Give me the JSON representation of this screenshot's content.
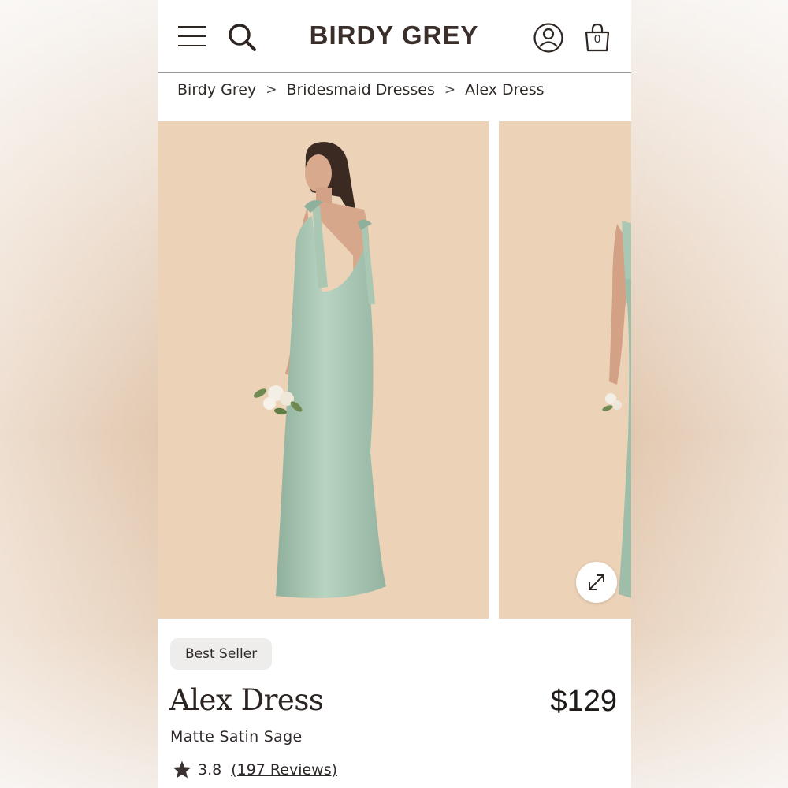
{
  "header": {
    "logo": "BIRDY GREY",
    "bag_count": "0"
  },
  "breadcrumb": {
    "items": [
      "Birdy Grey",
      "Bridesmaid Dresses",
      "Alex Dress"
    ],
    "separator": ">"
  },
  "gallery": {
    "background_color": "#ecd2b7",
    "dress_color": "#a9c7b3"
  },
  "product": {
    "badge": "Best Seller",
    "title": "Alex Dress",
    "price": "$129",
    "variant": "Matte Satin Sage",
    "rating": "3.8",
    "reviews_label": "(197 Reviews)"
  },
  "icons": [
    "menu-icon",
    "search-icon",
    "account-icon",
    "bag-icon",
    "expand-icon",
    "star-icon"
  ]
}
